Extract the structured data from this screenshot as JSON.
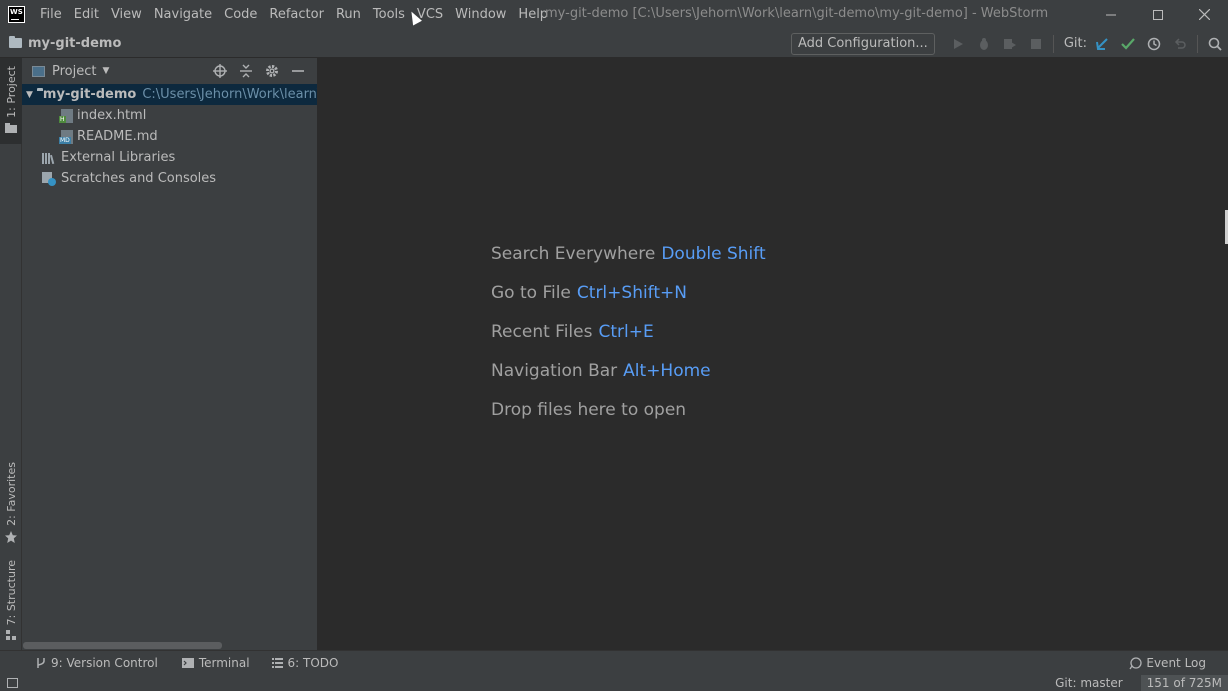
{
  "app": {
    "logo_text": "WS",
    "window_title": "my-git-demo [C:\\Users\\Jehorn\\Work\\learn\\git-demo\\my-git-demo] - WebStorm"
  },
  "menu": {
    "items": [
      {
        "label": "File"
      },
      {
        "label": "Edit"
      },
      {
        "label": "View"
      },
      {
        "label": "Navigate"
      },
      {
        "label": "Code"
      },
      {
        "label": "Refactor"
      },
      {
        "label": "Run"
      },
      {
        "label": "Tools"
      },
      {
        "label": "VCS"
      },
      {
        "label": "Window"
      },
      {
        "label": "Help"
      }
    ]
  },
  "navbar": {
    "breadcrumb": "my-git-demo",
    "add_configuration": "Add Configuration...",
    "git_label": "Git:"
  },
  "stripe": {
    "project_tab": "1: Project",
    "favorites_tab": "2: Favorites",
    "structure_tab": "7: Structure"
  },
  "project_panel": {
    "title": "Project",
    "root": {
      "name": "my-git-demo",
      "path": "C:\\Users\\Jehorn\\Work\\learn\\"
    },
    "files": [
      {
        "name": "index.html",
        "tag": "H"
      },
      {
        "name": "README.md",
        "tag": "MD"
      }
    ],
    "external_libraries": "External Libraries",
    "scratches": "Scratches and Consoles"
  },
  "editor": {
    "hints": [
      {
        "label": "Search Everywhere",
        "key": "Double Shift"
      },
      {
        "label": "Go to File",
        "key": "Ctrl+Shift+N"
      },
      {
        "label": "Recent Files",
        "key": "Ctrl+E"
      },
      {
        "label": "Navigation Bar",
        "key": "Alt+Home"
      }
    ],
    "drop_text": "Drop files here to open"
  },
  "bottom_bar": {
    "version_control": "9: Version Control",
    "terminal": "Terminal",
    "todo": "6: TODO",
    "event_log": "Event Log"
  },
  "status": {
    "git_branch": "Git: master",
    "memory": "151 of 725M"
  },
  "colors": {
    "background": "#2b2b2b",
    "panel": "#3c3f41",
    "selection": "#0d293e",
    "shortcut": "#589df6",
    "git_update": "#3592c4",
    "git_commit": "#59a869"
  }
}
